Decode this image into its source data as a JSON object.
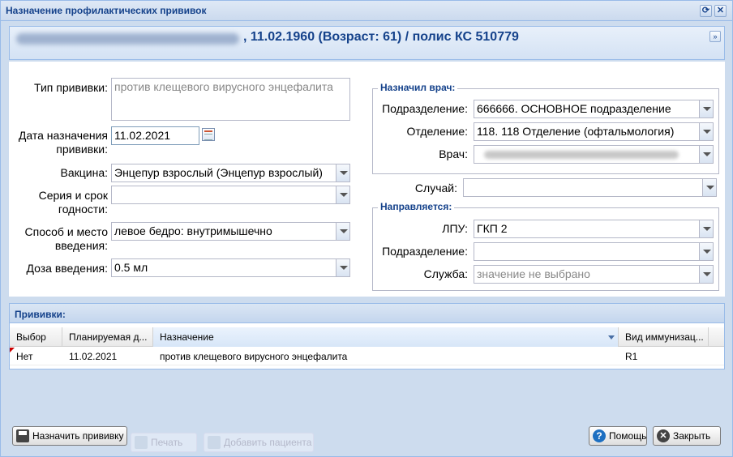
{
  "window": {
    "title": "Назначение профилактических прививок",
    "refresh_glyph": "⟳",
    "close_glyph": "✕"
  },
  "patient": {
    "info": ", 11.02.1960 (Возраст: 61) / полис КС 510779",
    "collapse_glyph": "»"
  },
  "form": {
    "vaccination_type": {
      "label": "Тип прививки:",
      "value": "против клещевого вирусного энцефалита"
    },
    "date": {
      "label_line1": "Дата назначения",
      "label_line2": "прививки:",
      "value": "11.02.2021"
    },
    "vaccine": {
      "label": "Вакцина:",
      "value": "Энцепур взрослый (Энцепур взрослый)"
    },
    "series": {
      "label_line1": "Серия и срок",
      "label_line2": "годности:",
      "value": ""
    },
    "method": {
      "label_line1": "Способ и место",
      "label_line2": "введения:",
      "value": "левое бедро: внутримышечно"
    },
    "dose": {
      "label": "Доза введения:",
      "value": "0.5 мл"
    }
  },
  "doctor": {
    "legend": "Назначил врач:",
    "division": {
      "label": "Подразделение:",
      "value": "666666. ОСНОВНОЕ подразделение"
    },
    "department": {
      "label": "Отделение:",
      "value": "118. 118 Отделение (офтальмология)"
    },
    "doctor": {
      "label": "Врач:"
    }
  },
  "case": {
    "label": "Случай:",
    "value": ""
  },
  "directed": {
    "legend": "Направляется:",
    "lpu": {
      "label": "ЛПУ:",
      "value": "ГКП 2"
    },
    "division": {
      "label": "Подразделение:",
      "value": ""
    },
    "service": {
      "label": "Служба:",
      "placeholder": "значение не выбрано"
    }
  },
  "grid": {
    "title": "Прививки:",
    "columns": [
      "Выбор",
      "Планируемая д...",
      "Назначение",
      "Вид иммунизац..."
    ],
    "rows": [
      {
        "choice": "Нет",
        "date": "11.02.2021",
        "purpose": "против клещевого вирусного энцефалита",
        "kind": "R1"
      }
    ]
  },
  "buttons": {
    "assign": "Назначить прививку",
    "print": "Печать",
    "add_patient": "Добавить пациента",
    "help": "Помощь",
    "close": "Закрыть"
  }
}
